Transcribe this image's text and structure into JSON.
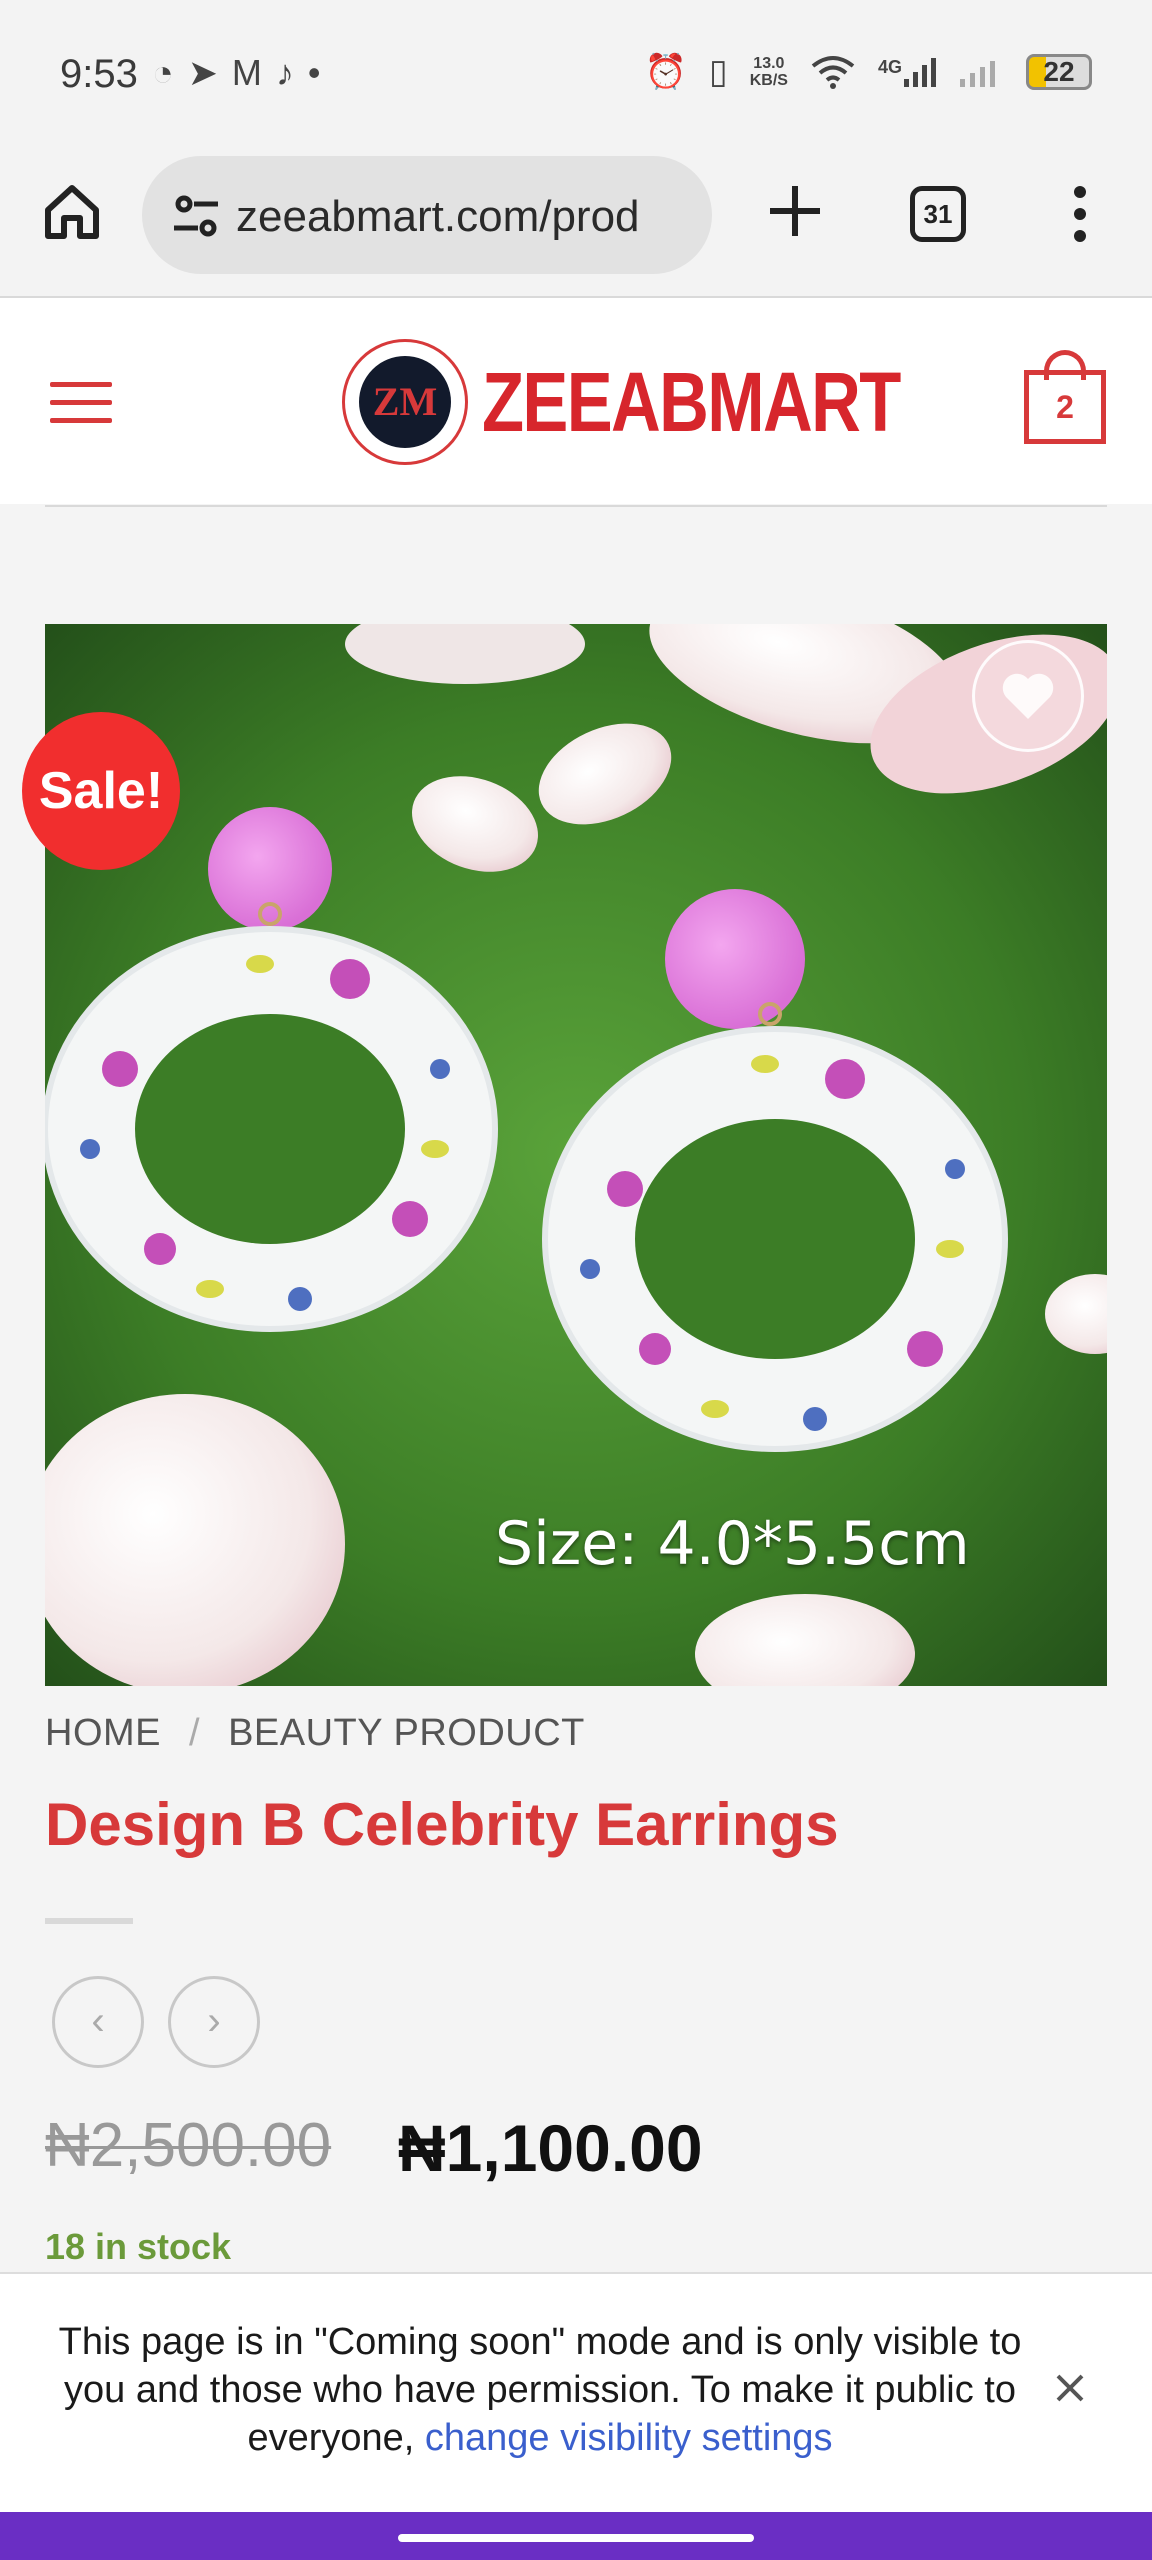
{
  "status_bar": {
    "time": "9:53",
    "left_icons": [
      "whatsapp-icon",
      "telegram-icon",
      "gmail-icon",
      "tiktok-icon",
      "dot-icon"
    ],
    "net_speed_value": "13.0",
    "net_speed_unit": "KB/S",
    "network": "4G",
    "battery": "22"
  },
  "browser": {
    "url": "zeeabmart.com/prod",
    "tabs_count": "31"
  },
  "site": {
    "logo_text": "ZEEABMART",
    "logo_monogram": "ZM",
    "cart_count": "2"
  },
  "product": {
    "sale_badge": "Sale!",
    "image_caption": "Size: 4.0*5.5cm",
    "breadcrumb": [
      "HOME",
      "BEAUTY PRODUCT"
    ],
    "breadcrumb_separator": "/",
    "title": "Design B Celebrity Earrings",
    "old_price": "₦2,500.00",
    "new_price": "₦1,100.00",
    "stock": "18 in stock"
  },
  "notice": {
    "text": "This page is in \"Coming soon\" mode and is only visible to you and those who have permission. To make it public to everyone, ",
    "link": "change visibility settings"
  },
  "colors": {
    "brand_red": "#d7393a",
    "sale_red": "#f12e2e",
    "stock_green": "#6b9a3a",
    "link_blue": "#3a5fcd",
    "bottom_bar": "#6a2ec4"
  }
}
